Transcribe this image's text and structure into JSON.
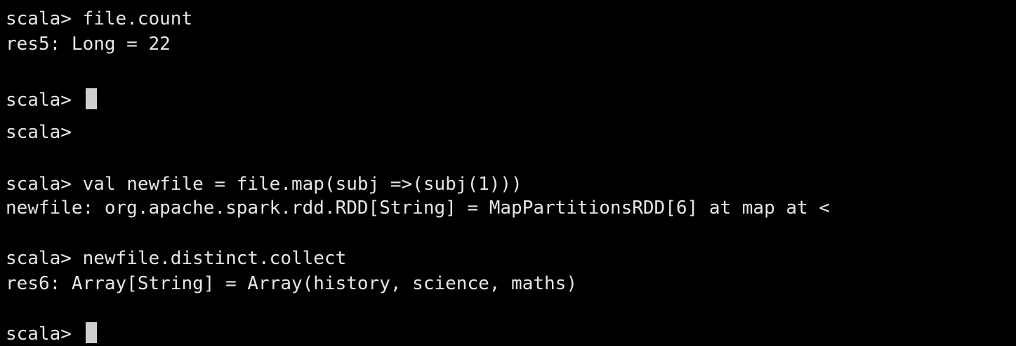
{
  "terminal": {
    "prompt": "scala> ",
    "colors": {
      "background": "#000000",
      "text": "#e6e6e6",
      "cursor": "#cfcfcf"
    },
    "lines": [
      {
        "kind": "input",
        "text": "file.count"
      },
      {
        "kind": "output",
        "text": "res5: Long = 22"
      },
      {
        "kind": "input",
        "text": ""
      },
      {
        "kind": "input",
        "text": ""
      },
      {
        "kind": "input",
        "text": "val newfile = file.map(subj =>(subj(1)))"
      },
      {
        "kind": "output",
        "text": "newfile: org.apache.spark.rdd.RDD[String] = MapPartitionsRDD[6] at map at <"
      },
      {
        "kind": "input",
        "text": "newfile.distinct.collect"
      },
      {
        "kind": "output",
        "text": "res6: Array[String] = Array(history, science, maths)"
      },
      {
        "kind": "input",
        "text": ""
      }
    ]
  }
}
